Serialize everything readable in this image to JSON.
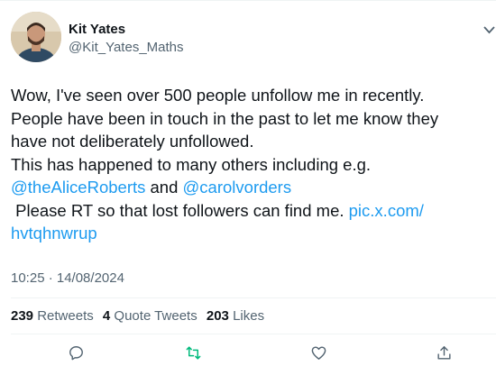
{
  "author": {
    "display_name": "Kit Yates",
    "handle": "@Kit_Yates_Maths"
  },
  "tweet": {
    "line1": "Wow, I've seen over 500 people unfollow me in recently.",
    "line2": "People have been in touch in the past to let me know they",
    "line3": "have not deliberately unfollowed.",
    "line4": "This has happened to many others including e.g.",
    "mention1": "@theAliceRoberts",
    "and_word": " and ",
    "mention2": "@carolvorders",
    "line6": " Please RT so that lost followers can find me. ",
    "link_part1": "pic.x.com/",
    "link_part2": "hvtqhnwrup"
  },
  "timestamp": "10:25 · 14/08/2024",
  "stats": {
    "retweets_count": "239",
    "retweets_label": "Retweets",
    "quotes_count": "4",
    "quotes_label": "Quote Tweets",
    "likes_count": "203",
    "likes_label": "Likes"
  },
  "icons": {
    "reply": "reply-icon",
    "retweet": "retweet-icon",
    "like": "heart-icon",
    "share": "share-icon",
    "more": "chevron-down-icon"
  },
  "colors": {
    "text": "#0f1419",
    "muted": "#536471",
    "link": "#1d9bf0",
    "retweet": "#00ba7c",
    "divider": "#eff3f4"
  }
}
